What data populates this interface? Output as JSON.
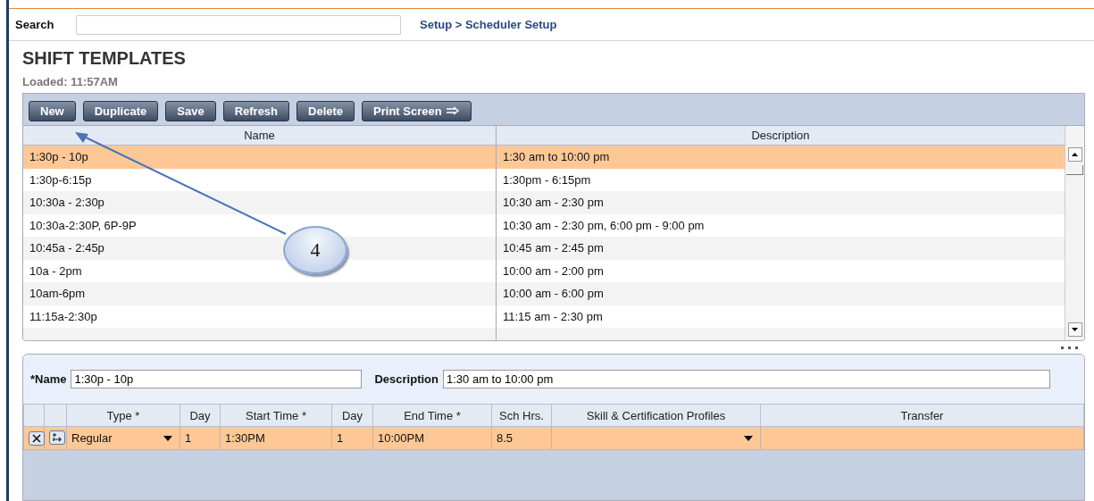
{
  "search": {
    "label": "Search"
  },
  "breadcrumb": "Setup > Scheduler Setup",
  "title": "SHIFT TEMPLATES",
  "loaded": "Loaded: 11:57AM",
  "toolbar": [
    {
      "label": "New",
      "arrow": false
    },
    {
      "label": "Duplicate",
      "arrow": false
    },
    {
      "label": "Save",
      "arrow": false
    },
    {
      "label": "Refresh",
      "arrow": false
    },
    {
      "label": "Delete",
      "arrow": false
    },
    {
      "label": "Print Screen",
      "arrow": true
    }
  ],
  "templates": {
    "columns": [
      "Name",
      "Description"
    ],
    "rows": [
      {
        "name": "1:30p - 10p",
        "description": "1:30 am to 10:00 pm",
        "selected": true
      },
      {
        "name": "1:30p-6:15p",
        "description": "1:30pm - 6:15pm",
        "selected": false
      },
      {
        "name": "10:30a - 2:30p",
        "description": "10:30 am - 2:30 pm",
        "selected": false
      },
      {
        "name": "10:30a-2:30P, 6P-9P",
        "description": "10:30 am - 2:30 pm, 6:00 pm - 9:00 pm",
        "selected": false
      },
      {
        "name": "10:45a - 2:45p",
        "description": "10:45 am - 2:45 pm",
        "selected": false
      },
      {
        "name": "10a - 2pm",
        "description": "10:00 am - 2:00 pm",
        "selected": false
      },
      {
        "name": "10am-6pm",
        "description": "10:00 am - 6:00 pm",
        "selected": false
      },
      {
        "name": "11:15a-2:30p",
        "description": "11:15 am - 2:30 pm",
        "selected": false
      }
    ]
  },
  "form": {
    "name_label": "*Name",
    "name_value": "1:30p - 10p",
    "description_label": "Description",
    "description_value": "1:30 am to 10:00 pm"
  },
  "shifts": {
    "columns": [
      "Type *",
      "Day",
      "Start Time *",
      "Day",
      "End Time *",
      "Sch Hrs.",
      "Skill & Certification Profiles",
      "Transfer"
    ],
    "rows": [
      {
        "type": "Regular",
        "start_day": "1",
        "start_time": "1:30PM",
        "end_day": "1",
        "end_time": "10:00PM",
        "hours": "8.5",
        "selected": true
      }
    ]
  },
  "callout": {
    "number": "4"
  }
}
